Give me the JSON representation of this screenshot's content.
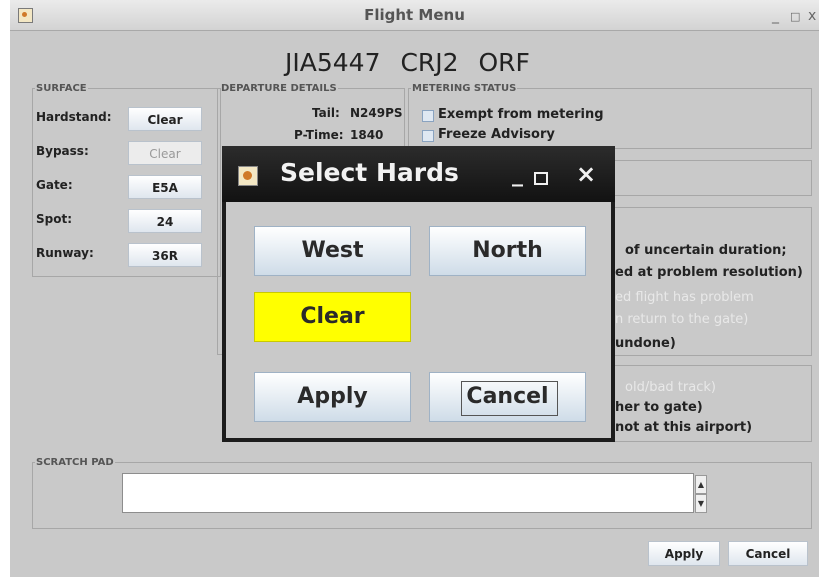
{
  "window": {
    "title": "Flight Menu",
    "min": "_",
    "max": "□",
    "close": "x"
  },
  "flight": {
    "callsign": "JIA5447",
    "aircraft": "CRJ2",
    "destination": "ORF"
  },
  "surface": {
    "legend": "SURFACE",
    "rows": [
      {
        "label": "Hardstand:",
        "value": "Clear",
        "enabled": true
      },
      {
        "label": "Bypass:",
        "value": "Clear",
        "enabled": false
      },
      {
        "label": "Gate:",
        "value": "E5A",
        "enabled": true
      },
      {
        "label": "Spot:",
        "value": "24",
        "enabled": true
      },
      {
        "label": "Runway:",
        "value": "36R",
        "enabled": true
      }
    ]
  },
  "departure": {
    "legend": "DEPARTURE DETAILS",
    "tail_label": "Tail:",
    "tail": "N249PS",
    "ptime_label": "P-Time:",
    "ptime": "1840"
  },
  "metering": {
    "legend": "METERING STATUS",
    "exempt": "Exempt from metering",
    "freeze": "Freeze Advisory"
  },
  "partial": {
    "line1": "of uncertain duration;",
    "line2": "ed at problem resolution)",
    "line3": "ed flight has problem",
    "line4": "n return to the gate)",
    "line5": "undone)",
    "line6": "old/bad track)",
    "line7": "her to gate)",
    "line8": "not at this airport)"
  },
  "scratch": {
    "legend": "SCRATCH PAD",
    "value": ""
  },
  "footer": {
    "apply": "Apply",
    "cancel": "Cancel"
  },
  "dialog": {
    "title": "Select Hards",
    "min": "_",
    "close": "×",
    "west": "West",
    "north": "North",
    "clear": "Clear",
    "apply": "Apply",
    "cancel": "Cancel"
  },
  "colors": {
    "selected": "#ffff00",
    "window_bg": "#c9c9c9",
    "dialog_bg": "#1c1c1c"
  }
}
